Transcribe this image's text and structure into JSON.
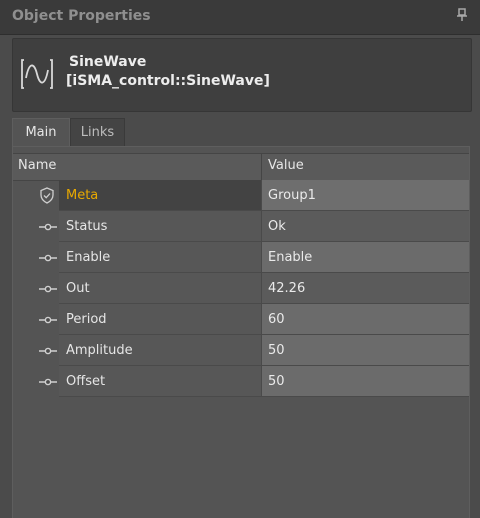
{
  "window": {
    "title": "Object Properties",
    "pin_icon": "pin-icon"
  },
  "object": {
    "name": "SineWave",
    "type": "[iSMA_control::SineWave]",
    "icon": "sine-wave-icon"
  },
  "tabs": [
    {
      "label": "Main",
      "active": true
    },
    {
      "label": "Links",
      "active": false
    }
  ],
  "grid": {
    "columns": {
      "name": "Name",
      "value": "Value"
    },
    "rows": [
      {
        "name": "Meta",
        "value": "Group1",
        "icon": "shield-check-icon",
        "highlight": true
      },
      {
        "name": "Status",
        "value": "Ok",
        "icon": "slot-icon"
      },
      {
        "name": "Enable",
        "value": "Enable",
        "icon": "slot-icon"
      },
      {
        "name": "Out",
        "value": "42.26",
        "icon": "slot-icon"
      },
      {
        "name": "Period",
        "value": "60",
        "icon": "slot-icon"
      },
      {
        "name": "Amplitude",
        "value": "50",
        "icon": "slot-icon"
      },
      {
        "name": "Offset",
        "value": "50",
        "icon": "slot-icon"
      }
    ]
  },
  "colors": {
    "accent_meta": "#e8a900",
    "panel_bg": "#4b4b4b",
    "titlebar_bg": "#3a3a3a"
  }
}
